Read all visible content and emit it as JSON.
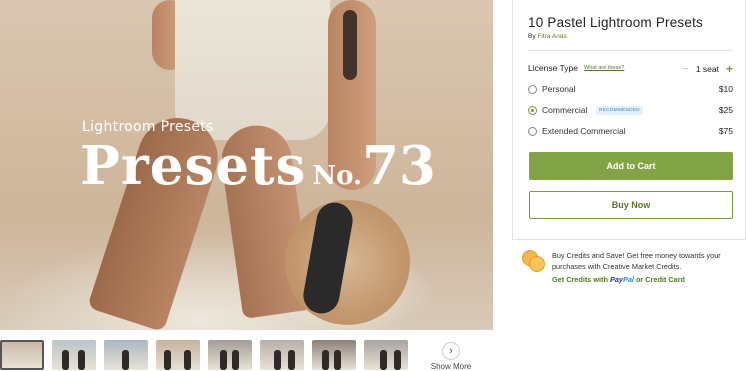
{
  "hero": {
    "subtitle": "Lightroom Presets",
    "title_word": "Presets",
    "title_no": "No.",
    "title_number": "73"
  },
  "thumbnails": [
    {
      "label": "Presets No.73",
      "active": true,
      "color": "#c9b9a3"
    },
    {
      "label": "",
      "active": false,
      "color": "#b9c5c9"
    },
    {
      "label": "",
      "active": false,
      "color": "#a8b8c0"
    },
    {
      "label": "",
      "active": false,
      "color": "#c5b29a"
    },
    {
      "label": "",
      "active": false,
      "color": "#a59c94"
    },
    {
      "label": "",
      "active": false,
      "color": "#b8b0a6"
    },
    {
      "label": "",
      "active": false,
      "color": "#8c8178"
    },
    {
      "label": "",
      "active": false,
      "color": "#a8a59f"
    }
  ],
  "show_more": {
    "label": "Show More",
    "icon": "chevron-right-icon"
  },
  "product": {
    "title": "10 Pastel Lightroom Presets",
    "by_prefix": "By",
    "author": "Fitra Anas"
  },
  "license": {
    "label": "License Type",
    "help_link": "What are these?",
    "seat_text": "1 seat",
    "minus": "−",
    "plus": "+",
    "options": [
      {
        "name": "Personal",
        "price": "$10",
        "selected": false,
        "badge": ""
      },
      {
        "name": "Commercial",
        "price": "$25",
        "selected": true,
        "badge": "RECOMMENDED"
      },
      {
        "name": "Extended Commercial",
        "price": "$75",
        "selected": false,
        "badge": ""
      }
    ]
  },
  "buttons": {
    "add_to_cart": "Add to Cart",
    "buy_now": "Buy Now"
  },
  "promo": {
    "text": "Buy Credits and Save! Get free money towards your purchases with Creative Market Credits.",
    "get_credits_with": "Get Credits with",
    "paypal_pay": "Pay",
    "paypal_pal": "Pal",
    "or_text": "or Credit Card"
  },
  "colors": {
    "accent_green": "#82a447",
    "link_green": "#5a7a2a",
    "badge_blue": "#3c86c4"
  }
}
